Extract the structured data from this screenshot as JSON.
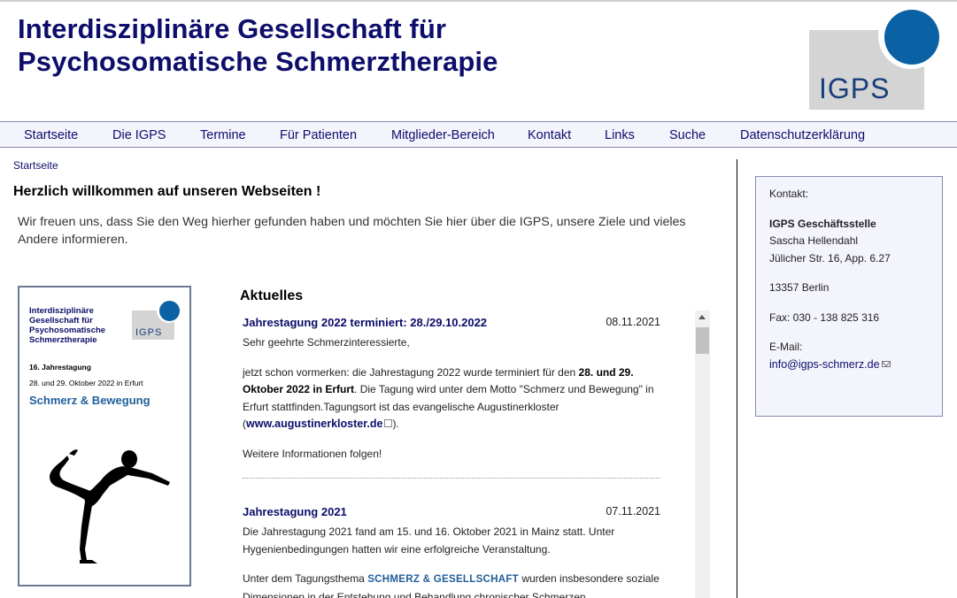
{
  "site": {
    "title_line1": "Interdisziplinäre Gesellschaft für",
    "title_line2": "Psychosomatische Schmerztherapie",
    "logo_text": "IGPS"
  },
  "colors": {
    "brand_dark": "#0d0d6b",
    "logo_blue": "#0a61a3",
    "logo_grey": "#d4d4d4",
    "nav_background": "#f3f4fc",
    "theme_blue": "#1f5f9a"
  },
  "nav": {
    "items": [
      {
        "label": "Startseite"
      },
      {
        "label": "Die IGPS"
      },
      {
        "label": "Termine"
      },
      {
        "label": "Für Patienten"
      },
      {
        "label": "Mitglieder-Bereich"
      },
      {
        "label": "Kontakt"
      },
      {
        "label": "Links"
      },
      {
        "label": "Suche"
      },
      {
        "label": "Datenschutzerklärung"
      }
    ]
  },
  "breadcrumb": "Startseite",
  "welcome": {
    "heading": "Herzlich willkommen auf unseren Webseiten !",
    "intro": "Wir freuen uns, dass Sie den Weg hierher gefunden haben und möchten Sie hier über die IGPS, unsere Ziele und vieles Andere informieren."
  },
  "poster": {
    "title_line1": "Interdisziplinäre",
    "title_line2": "Gesellschaft für",
    "title_line3": "Psychosomatische",
    "title_line4": "Schmerztherapie",
    "logo_text": "IGPS",
    "edition": "16. Jahrestagung",
    "date": "28. und 29. Oktober 2022 in Erfurt",
    "theme": "Schmerz & Bewegung",
    "figure_icon": "yoga-silhouette-icon"
  },
  "news": {
    "heading": "Aktuelles",
    "items": [
      {
        "title": "Jahrestagung 2022 terminiert: 28./29.10.2022",
        "date": "08.11.2021",
        "p1": "Sehr geehrte Schmerzinteressierte,",
        "p2_a": "jetzt schon vormerken: die Jahrestagung 2022 wurde terminiert für den ",
        "p2_b": "28. und 29. Oktober 2022 in Erfurt",
        "p2_c": ". Die Tagung wird unter dem Motto \"Schmerz und Bewegung\" in Erfurt stattfinden.Tagungsort ist das evangelische Augustinerkloster (",
        "p2_link": "www.augustinerkloster.de",
        "p2_d": ").",
        "p3": "Weitere Informationen folgen!"
      },
      {
        "title": "Jahrestagung 2021",
        "date": "07.11.2021",
        "p1": "Die Jahrestagung 2021 fand am 15. und 16. Oktober 2021 in Mainz statt. Unter Hygenienbedingungen hatten wir eine erfolgreiche Veranstaltung.",
        "p2_a": "Unter dem Tagungsthema ",
        "p2_theme": "SCHMERZ & GESELLSCHAFT",
        "p2_b": " wurden insbesondere soziale Dimensionen in der Entstehung und Behandlung chronischer Schmerzen"
      }
    ]
  },
  "contact": {
    "label": "Kontakt:",
    "org": "IGPS Geschäftsstelle",
    "name": "Sascha Hellendahl",
    "street": "Jülicher Str. 16, App. 6.27",
    "city": "13357 Berlin",
    "fax": "Fax: 030 - 138 825 316",
    "email_label": "E-Mail:",
    "email": "info@igps-schmerz.de"
  }
}
